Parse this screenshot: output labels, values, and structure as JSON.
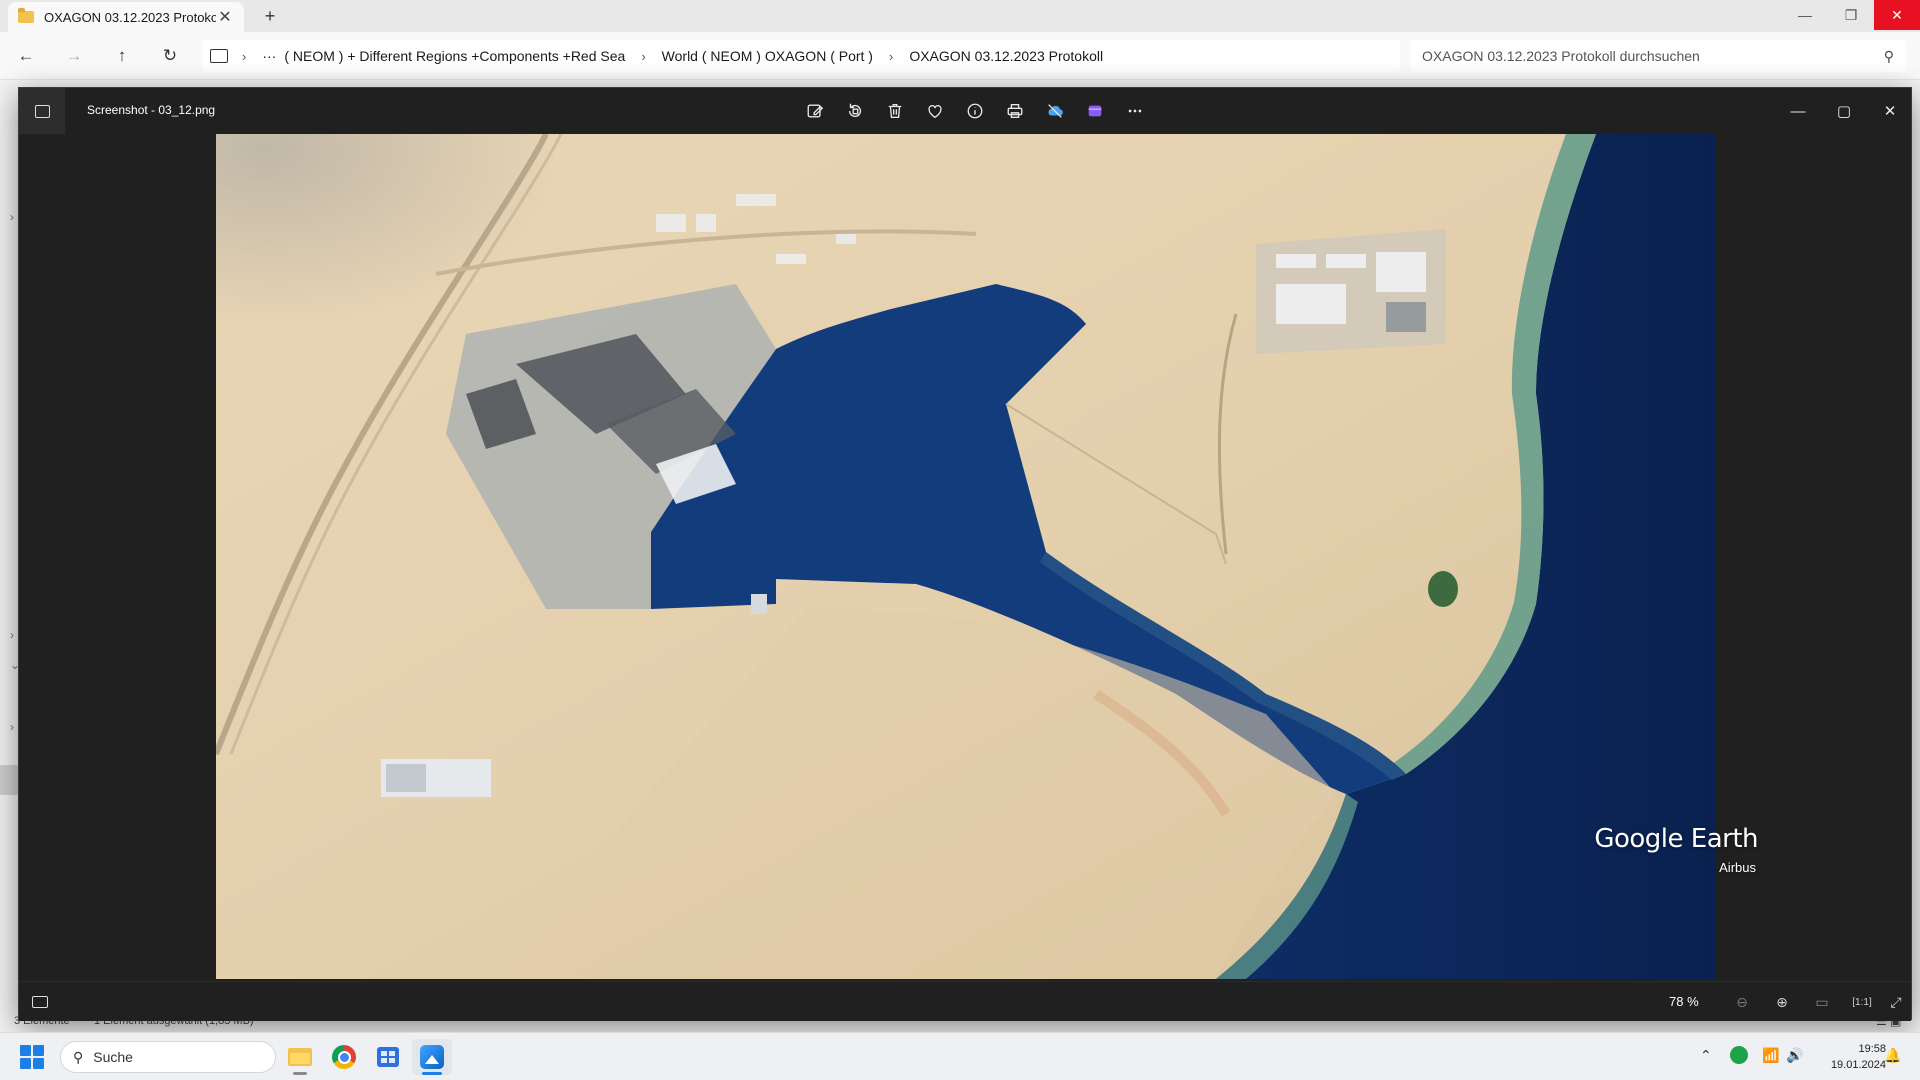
{
  "explorer": {
    "tab_title": "OXAGON 03.12.2023 Protokoll",
    "breadcrumb": [
      "( NEOM ) + Different Regions +Components +Red Sea",
      "World ( NEOM ) OXAGON ( Port )",
      "OXAGON 03.12.2023 Protokoll"
    ],
    "search_placeholder": "OXAGON 03.12.2023 Protokoll durchsuchen",
    "status_count": "3 Elemente",
    "status_selection": "1 Element ausgewählt (1,83 MB)"
  },
  "viewer": {
    "file_name": "Screenshot - 03_12.png",
    "zoom": "78 %",
    "watermark_brand": "Google Earth",
    "watermark_credit": "Airbus",
    "toolbar_icons": [
      "edit-icon",
      "rotate-icon",
      "delete-icon",
      "favorite-icon",
      "info-icon",
      "print-icon",
      "onedrive-icon",
      "clipchamp-icon",
      "more-icon"
    ]
  },
  "taskbar": {
    "search_label": "Suche",
    "time": "19:58",
    "date": "19.01.2024"
  },
  "colors": {
    "sea": "#0d2a5c",
    "harbor_water": "#123a7a",
    "sand": "#e3cfae",
    "viewer_bg": "#202020",
    "close_red": "#e81123",
    "accent_blue": "#1c7ee6"
  }
}
